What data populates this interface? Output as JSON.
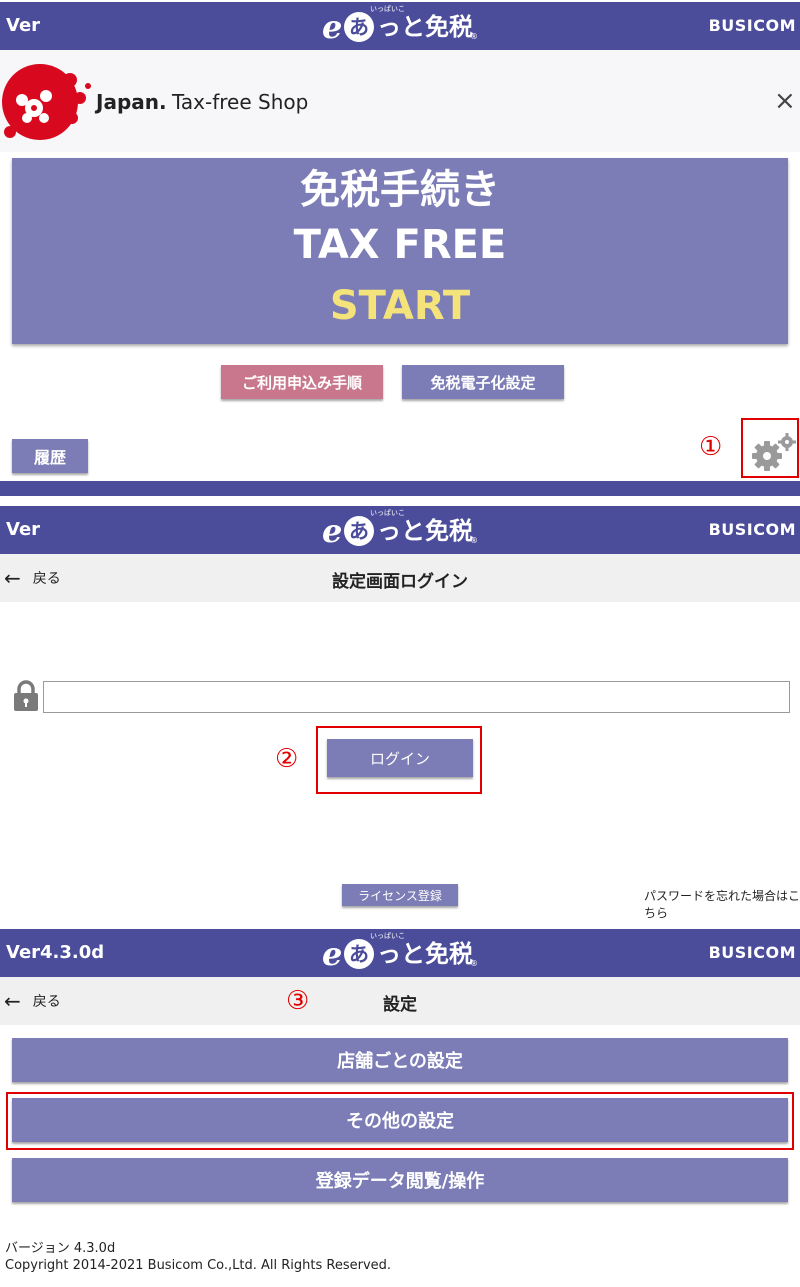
{
  "screen1": {
    "ver": "Ver",
    "logo": {
      "e": "e",
      "circle": "あ",
      "rest": "っと免税",
      "ruby": "いっぱいこ",
      "mark": "®"
    },
    "brand": "BUSICOM",
    "shop_bold": "Japan.",
    "shop_rest": "Tax-free Shop",
    "close": "×",
    "start": {
      "line1": "免税手続き",
      "line2": "TAX FREE",
      "line3": "START"
    },
    "apply_button": "ご利用申込み手順",
    "digital_button": "免税電子化設定",
    "history_button": "履歴",
    "annotation": "①"
  },
  "screen2": {
    "ver": "Ver",
    "logo": {
      "e": "e",
      "circle": "あ",
      "rest": "っと免税",
      "ruby": "いっぱいこ",
      "mark": "®"
    },
    "brand": "BUSICOM",
    "back": "戻る",
    "title": "設定画面ログイン",
    "password_value": "",
    "login_button": "ログイン",
    "annotation": "②",
    "license_button": "ライセンス登録",
    "forgot_link": "パスワードを忘れた場合はこちら"
  },
  "screen3": {
    "ver": "Ver4.3.0d",
    "logo": {
      "e": "e",
      "circle": "あ",
      "rest": "っと免税",
      "ruby": "いっぱいこ",
      "mark": "®"
    },
    "brand": "BUSICOM",
    "back": "戻る",
    "title": "設定",
    "annotation": "③",
    "menu": [
      "店舗ごとの設定",
      "その他の設定",
      "登録データ閲覧/操作"
    ],
    "version": "バージョン 4.3.0d",
    "copyright": "Copyright 2014-2021 Busicom Co.,Ltd. All Rights Reserved."
  },
  "colors": {
    "bar": "#4b4d9a",
    "button": "#7c7cb6",
    "pink": "#c9778c",
    "yellow": "#f4e27a",
    "annotation": "#e00000"
  }
}
